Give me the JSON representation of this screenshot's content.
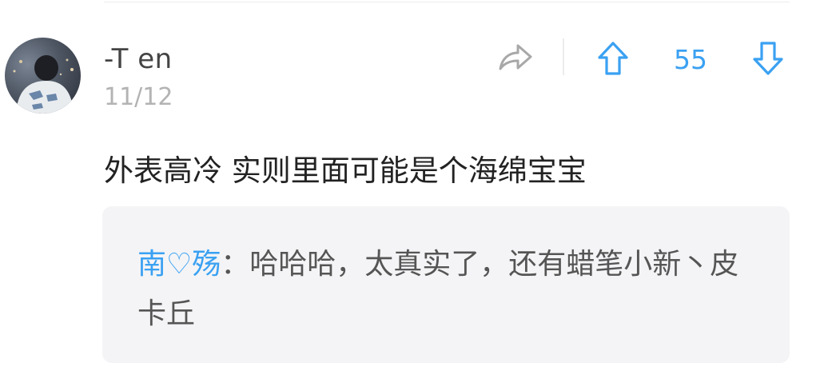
{
  "comment": {
    "username": "-T en",
    "date": "11/12",
    "text": "外表高冷 实则里面可能是个海绵宝宝",
    "vote_count": "55"
  },
  "reply": {
    "author": "南♡殇",
    "separator": "：",
    "text": "哈哈哈，太真实了，还有蜡笔小新丶皮卡丘"
  },
  "icons": {
    "share": "share-arrow-icon",
    "upvote": "upvote-arrow-icon",
    "downvote": "downvote-arrow-icon"
  },
  "colors": {
    "accent": "#3aa1f2",
    "icon_gray": "#a8a8a8",
    "reply_bg": "#f4f4f6"
  }
}
